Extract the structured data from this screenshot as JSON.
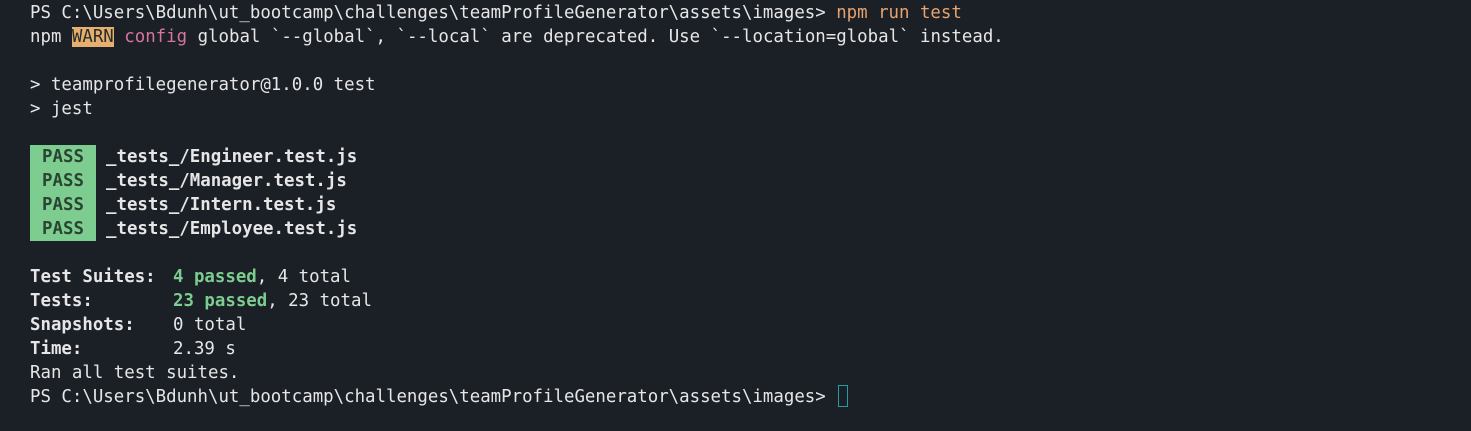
{
  "terminal": {
    "prompt1": "PS C:\\Users\\Bdunh\\ut_bootcamp\\challenges\\teamProfileGenerator\\assets\\images> ",
    "command": "npm run test",
    "warn": {
      "prefix": "npm ",
      "badge": "WARN",
      "category": "config",
      "message": " global `--global`, `--local` are deprecated. Use `--location=global` instead."
    },
    "script_header": "> teamprofilegenerator@1.0.0 test",
    "script_cmd": "> jest",
    "test_results": [
      {
        "status": "PASS",
        "file": "_tests_/Engineer.test.js"
      },
      {
        "status": "PASS",
        "file": "_tests_/Manager.test.js"
      },
      {
        "status": "PASS",
        "file": "_tests_/Intern.test.js"
      },
      {
        "status": "PASS",
        "file": "_tests_/Employee.test.js"
      }
    ],
    "summary": {
      "suites_label": "Test Suites:",
      "suites_passed": "4 passed",
      "suites_total": ", 4 total",
      "tests_label": "Tests:",
      "tests_passed": "23 passed",
      "tests_total": ", 23 total",
      "snapshots_label": "Snapshots:",
      "snapshots_value": "0 total",
      "time_label": "Time:",
      "time_value": "2.39 s"
    },
    "ran_all": "Ran all test suites.",
    "prompt2": "PS C:\\Users\\Bdunh\\ut_bootcamp\\challenges\\teamProfileGenerator\\assets\\images> "
  },
  "colors": {
    "background": "#1b1f26",
    "text": "#e6e6e6",
    "command": "#e5a36f",
    "warn_badge": "#e5b06f",
    "config": "#d8759b",
    "pass_badge": "#7ccd8f",
    "passed_text": "#7ccd8f",
    "cursor": "#1f9ea5"
  }
}
